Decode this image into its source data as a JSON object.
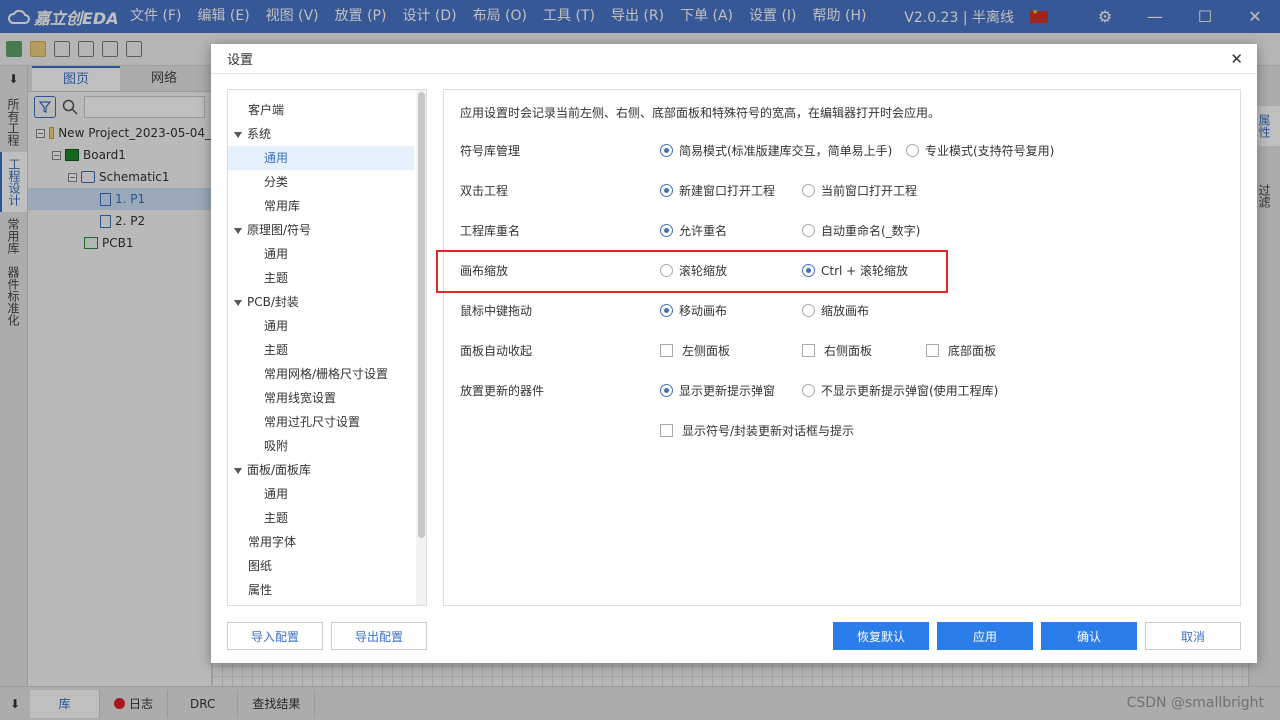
{
  "app": {
    "logo_text": "嘉立创EDA",
    "version": "V2.0.23 | 半离线",
    "menu": [
      "文件 (F)",
      "编辑 (E)",
      "视图 (V)",
      "放置 (P)",
      "设计 (D)",
      "布局 (O)",
      "工具 (T)",
      "导出 (R)",
      "下单 (A)",
      "设置 (I)",
      "帮助 (H)"
    ]
  },
  "left_vtabs": [
    "所有工程",
    "工程设计",
    "常用库",
    "器件标准化"
  ],
  "project_panel": {
    "tabs": [
      "图页",
      "网络"
    ],
    "tree": [
      {
        "label": "New Project_2023-05-04_"
      },
      {
        "label": "Board1"
      },
      {
        "label": "Schematic1"
      },
      {
        "label": "1. P1"
      },
      {
        "label": "2. P2"
      },
      {
        "label": "PCB1"
      }
    ]
  },
  "right_vtabs": [
    "属性",
    "过滤"
  ],
  "bottom_tabs": [
    "库",
    "日志",
    "DRC",
    "查找结果"
  ],
  "watermark": "CSDN @smallbright",
  "dialog": {
    "title": "设置",
    "nav": [
      {
        "label": "客户端",
        "level": "l0"
      },
      {
        "label": "系统",
        "level": "grp"
      },
      {
        "label": "通用",
        "level": "l1",
        "active": true
      },
      {
        "label": "分类",
        "level": "l1"
      },
      {
        "label": "常用库",
        "level": "l1"
      },
      {
        "label": "原理图/符号",
        "level": "grp"
      },
      {
        "label": "通用",
        "level": "l1"
      },
      {
        "label": "主题",
        "level": "l1"
      },
      {
        "label": "PCB/封装",
        "level": "grp"
      },
      {
        "label": "通用",
        "level": "l1"
      },
      {
        "label": "主题",
        "level": "l1"
      },
      {
        "label": "常用网格/栅格尺寸设置",
        "level": "l1"
      },
      {
        "label": "常用线宽设置",
        "level": "l1"
      },
      {
        "label": "常用过孔尺寸设置",
        "level": "l1"
      },
      {
        "label": "吸附",
        "level": "l1"
      },
      {
        "label": "面板/面板库",
        "level": "grp"
      },
      {
        "label": "通用",
        "level": "l1"
      },
      {
        "label": "主题",
        "level": "l1"
      },
      {
        "label": "常用字体",
        "level": "l0"
      },
      {
        "label": "图纸",
        "level": "l0"
      },
      {
        "label": "属性",
        "level": "l0"
      }
    ],
    "description": "应用设置时会记录当前左侧、右侧、底部面板和特殊符号的宽高，在编辑器打开时会应用。",
    "settings": {
      "symbol_lib": {
        "label": "符号库管理",
        "opt1": "简易模式(标准版建库交互，简单易上手)",
        "opt2": "专业模式(支持符号复用)",
        "selected": 1
      },
      "double_click": {
        "label": "双击工程",
        "opt1": "新建窗口打开工程",
        "opt2": "当前窗口打开工程",
        "selected": 1
      },
      "rename": {
        "label": "工程库重名",
        "opt1": "允许重名",
        "opt2": "自动重命名(_数字)",
        "selected": 1
      },
      "canvas_zoom": {
        "label": "画布缩放",
        "opt1": "滚轮缩放",
        "opt2": "Ctrl + 滚轮缩放",
        "selected": 2
      },
      "middle_drag": {
        "label": "鼠标中键拖动",
        "opt1": "移动画布",
        "opt2": "缩放画布",
        "selected": 1
      },
      "auto_collapse": {
        "label": "面板自动收起",
        "opt1": "左侧面板",
        "opt2": "右侧面板",
        "opt3": "底部面板"
      },
      "place_update": {
        "label": "放置更新的器件",
        "opt1": "显示更新提示弹窗",
        "opt2": "不显示更新提示弹窗(使用工程库)",
        "selected": 1
      },
      "show_dialog": {
        "label": "显示符号/封装更新对话框与提示"
      }
    },
    "buttons": {
      "import": "导入配置",
      "export": "导出配置",
      "restore": "恢复默认",
      "apply": "应用",
      "ok": "确认",
      "cancel": "取消"
    }
  }
}
